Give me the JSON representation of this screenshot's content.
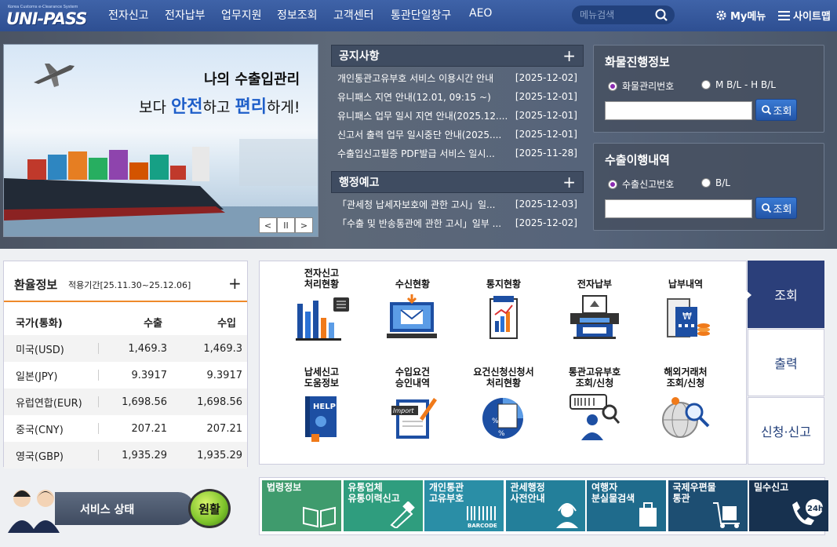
{
  "header": {
    "logo_sub": "Korea Customs e-Clearance System",
    "logo_main": "UNI-PASS",
    "nav": [
      "전자신고",
      "전자납부",
      "업무지원",
      "정보조회",
      "고객센터",
      "통관단일창구",
      "AEO"
    ],
    "search_placeholder": "메뉴검색",
    "my_menu": "My메뉴",
    "sitemap": "사이트맵"
  },
  "banner": {
    "line1": "나의 수출입관리",
    "line2_a": "보다 ",
    "line2_b": "안전",
    "line2_c": "하고 ",
    "line2_d": "편리",
    "line2_e": "하게!",
    "prev": "<",
    "pause": "II",
    "next": ">"
  },
  "notices": {
    "title": "공지사항",
    "more": "+",
    "items": [
      {
        "title": "개인통관고유부호 서비스 이용시간 안내",
        "date": "[2025-12-02]"
      },
      {
        "title": "유니패스 지연 안내(12.01, 09:15 ~)",
        "date": "[2025-12-01]"
      },
      {
        "title": "유니패스 업무 일시 지연 안내(2025.12....",
        "date": "[2025-12-01]"
      },
      {
        "title": "신고서 출력 업무 일시중단 안내(2025....",
        "date": "[2025-12-01]"
      },
      {
        "title": "수출입신고필증 PDF발급 서비스 일시...",
        "date": "[2025-11-28]"
      }
    ]
  },
  "admin_notices": {
    "title": "행정예고",
    "more": "+",
    "items": [
      {
        "title": "「관세청 납세자보호에 관한 고시」일...",
        "date": "[2025-12-03]"
      },
      {
        "title": "「수출 및 반송통관에 관한 고시」일부 ...",
        "date": "[2025-12-02]"
      }
    ]
  },
  "cargo": {
    "title": "화물진행정보",
    "opt1": "화물관리번호",
    "opt2": "M B/L - H B/L",
    "button": "조회"
  },
  "export": {
    "title": "수출이행내역",
    "opt1": "수출신고번호",
    "opt2": "B/L",
    "button": "조회"
  },
  "rates": {
    "title": "환율정보",
    "period": "적용기간[25.11.30~25.12.06]",
    "more": "+",
    "headers": [
      "국가(통화)",
      "수출",
      "수입"
    ],
    "rows": [
      [
        "미국(USD)",
        "1,469.3",
        "1,469.3"
      ],
      [
        "일본(JPY)",
        "9.3917",
        "9.3917"
      ],
      [
        "유럽연합(EUR)",
        "1,698.56",
        "1,698.56"
      ],
      [
        "중국(CNY)",
        "207.21",
        "207.21"
      ],
      [
        "영국(GBP)",
        "1,935.29",
        "1,935.29"
      ]
    ]
  },
  "services": {
    "items": [
      {
        "line1": "전자신고",
        "line2": "처리현황"
      },
      {
        "line1": "",
        "line2": "수신현황"
      },
      {
        "line1": "",
        "line2": "통지현황"
      },
      {
        "line1": "",
        "line2": "전자납부"
      },
      {
        "line1": "",
        "line2": "납부내역"
      },
      {
        "line1": "납세신고",
        "line2": "도움정보"
      },
      {
        "line1": "수입요건",
        "line2": "승인내역"
      },
      {
        "line1": "요건신청신청서",
        "line2": "처리현황"
      },
      {
        "line1": "통관고유부호",
        "line2": "조회/신청"
      },
      {
        "line1": "해외거래처",
        "line2": "조회/신청"
      }
    ],
    "help_text": "HELP",
    "import_text": "Import",
    "tabs": [
      "조회",
      "출력",
      "신청·신고"
    ]
  },
  "status": {
    "label": "서비스 상태",
    "value": "원활"
  },
  "quick": [
    {
      "line1": "법령정보",
      "line2": "",
      "color": "#3f9b6d"
    },
    {
      "line1": "유통업체",
      "line2": "유통이력신고",
      "color": "#2f9d7e"
    },
    {
      "line1": "개인통관",
      "line2": "고유부호",
      "color": "#2a8ea6"
    },
    {
      "line1": "관세행정",
      "line2": "사전안내",
      "color": "#237f9a"
    },
    {
      "line1": "여행자",
      "line2": "분실물검색",
      "color": "#1f6b8c"
    },
    {
      "line1": "국제우편물",
      "line2": "통관",
      "color": "#1d4e72"
    },
    {
      "line1": "밀수신고",
      "line2": "",
      "color": "#17314f"
    }
  ],
  "barcode_text": "BARCODE",
  "hours_text": "24h"
}
